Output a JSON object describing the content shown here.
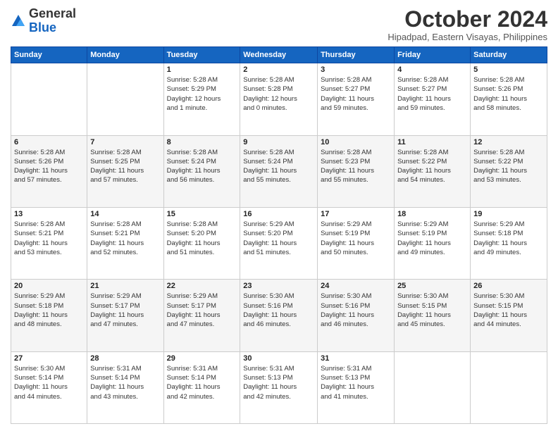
{
  "header": {
    "logo_general": "General",
    "logo_blue": "Blue",
    "month_title": "October 2024",
    "subtitle": "Hipadpad, Eastern Visayas, Philippines"
  },
  "weekdays": [
    "Sunday",
    "Monday",
    "Tuesday",
    "Wednesday",
    "Thursday",
    "Friday",
    "Saturday"
  ],
  "weeks": [
    [
      {
        "day": "",
        "info": ""
      },
      {
        "day": "",
        "info": ""
      },
      {
        "day": "1",
        "info": "Sunrise: 5:28 AM\nSunset: 5:29 PM\nDaylight: 12 hours\nand 1 minute."
      },
      {
        "day": "2",
        "info": "Sunrise: 5:28 AM\nSunset: 5:28 PM\nDaylight: 12 hours\nand 0 minutes."
      },
      {
        "day": "3",
        "info": "Sunrise: 5:28 AM\nSunset: 5:27 PM\nDaylight: 11 hours\nand 59 minutes."
      },
      {
        "day": "4",
        "info": "Sunrise: 5:28 AM\nSunset: 5:27 PM\nDaylight: 11 hours\nand 59 minutes."
      },
      {
        "day": "5",
        "info": "Sunrise: 5:28 AM\nSunset: 5:26 PM\nDaylight: 11 hours\nand 58 minutes."
      }
    ],
    [
      {
        "day": "6",
        "info": "Sunrise: 5:28 AM\nSunset: 5:26 PM\nDaylight: 11 hours\nand 57 minutes."
      },
      {
        "day": "7",
        "info": "Sunrise: 5:28 AM\nSunset: 5:25 PM\nDaylight: 11 hours\nand 57 minutes."
      },
      {
        "day": "8",
        "info": "Sunrise: 5:28 AM\nSunset: 5:24 PM\nDaylight: 11 hours\nand 56 minutes."
      },
      {
        "day": "9",
        "info": "Sunrise: 5:28 AM\nSunset: 5:24 PM\nDaylight: 11 hours\nand 55 minutes."
      },
      {
        "day": "10",
        "info": "Sunrise: 5:28 AM\nSunset: 5:23 PM\nDaylight: 11 hours\nand 55 minutes."
      },
      {
        "day": "11",
        "info": "Sunrise: 5:28 AM\nSunset: 5:22 PM\nDaylight: 11 hours\nand 54 minutes."
      },
      {
        "day": "12",
        "info": "Sunrise: 5:28 AM\nSunset: 5:22 PM\nDaylight: 11 hours\nand 53 minutes."
      }
    ],
    [
      {
        "day": "13",
        "info": "Sunrise: 5:28 AM\nSunset: 5:21 PM\nDaylight: 11 hours\nand 53 minutes."
      },
      {
        "day": "14",
        "info": "Sunrise: 5:28 AM\nSunset: 5:21 PM\nDaylight: 11 hours\nand 52 minutes."
      },
      {
        "day": "15",
        "info": "Sunrise: 5:28 AM\nSunset: 5:20 PM\nDaylight: 11 hours\nand 51 minutes."
      },
      {
        "day": "16",
        "info": "Sunrise: 5:29 AM\nSunset: 5:20 PM\nDaylight: 11 hours\nand 51 minutes."
      },
      {
        "day": "17",
        "info": "Sunrise: 5:29 AM\nSunset: 5:19 PM\nDaylight: 11 hours\nand 50 minutes."
      },
      {
        "day": "18",
        "info": "Sunrise: 5:29 AM\nSunset: 5:19 PM\nDaylight: 11 hours\nand 49 minutes."
      },
      {
        "day": "19",
        "info": "Sunrise: 5:29 AM\nSunset: 5:18 PM\nDaylight: 11 hours\nand 49 minutes."
      }
    ],
    [
      {
        "day": "20",
        "info": "Sunrise: 5:29 AM\nSunset: 5:18 PM\nDaylight: 11 hours\nand 48 minutes."
      },
      {
        "day": "21",
        "info": "Sunrise: 5:29 AM\nSunset: 5:17 PM\nDaylight: 11 hours\nand 47 minutes."
      },
      {
        "day": "22",
        "info": "Sunrise: 5:29 AM\nSunset: 5:17 PM\nDaylight: 11 hours\nand 47 minutes."
      },
      {
        "day": "23",
        "info": "Sunrise: 5:30 AM\nSunset: 5:16 PM\nDaylight: 11 hours\nand 46 minutes."
      },
      {
        "day": "24",
        "info": "Sunrise: 5:30 AM\nSunset: 5:16 PM\nDaylight: 11 hours\nand 46 minutes."
      },
      {
        "day": "25",
        "info": "Sunrise: 5:30 AM\nSunset: 5:15 PM\nDaylight: 11 hours\nand 45 minutes."
      },
      {
        "day": "26",
        "info": "Sunrise: 5:30 AM\nSunset: 5:15 PM\nDaylight: 11 hours\nand 44 minutes."
      }
    ],
    [
      {
        "day": "27",
        "info": "Sunrise: 5:30 AM\nSunset: 5:14 PM\nDaylight: 11 hours\nand 44 minutes."
      },
      {
        "day": "28",
        "info": "Sunrise: 5:31 AM\nSunset: 5:14 PM\nDaylight: 11 hours\nand 43 minutes."
      },
      {
        "day": "29",
        "info": "Sunrise: 5:31 AM\nSunset: 5:14 PM\nDaylight: 11 hours\nand 42 minutes."
      },
      {
        "day": "30",
        "info": "Sunrise: 5:31 AM\nSunset: 5:13 PM\nDaylight: 11 hours\nand 42 minutes."
      },
      {
        "day": "31",
        "info": "Sunrise: 5:31 AM\nSunset: 5:13 PM\nDaylight: 11 hours\nand 41 minutes."
      },
      {
        "day": "",
        "info": ""
      },
      {
        "day": "",
        "info": ""
      }
    ]
  ]
}
